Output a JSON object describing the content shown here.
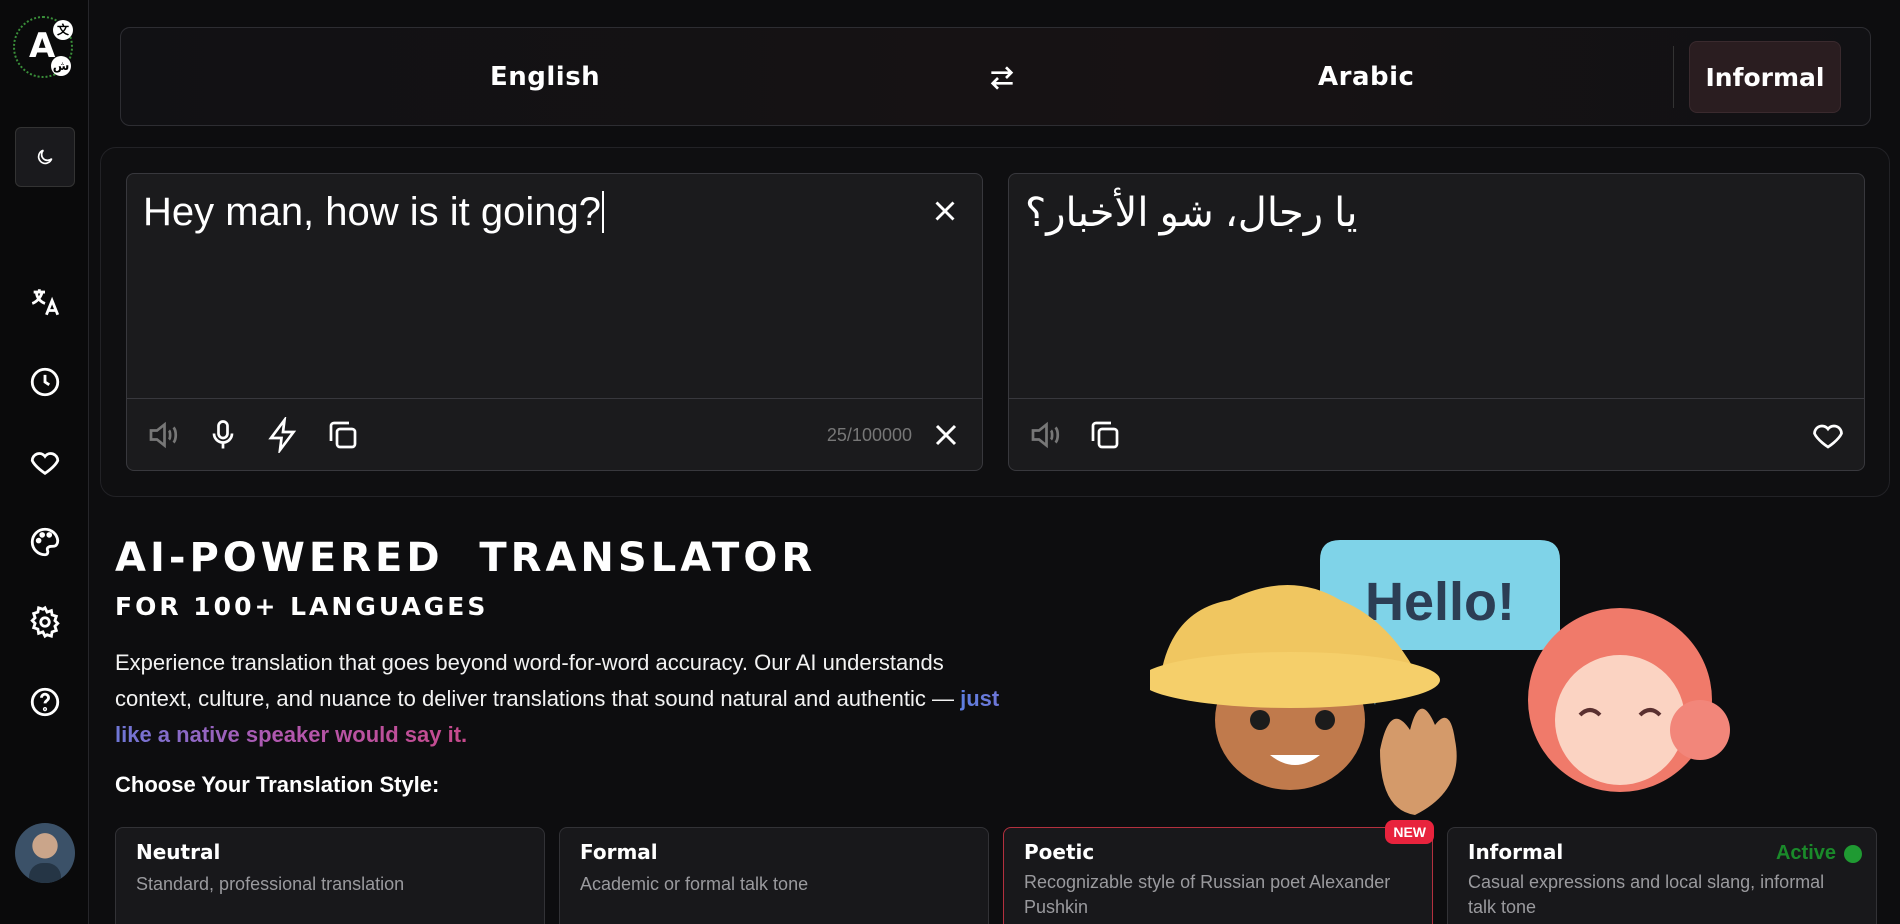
{
  "sidebar": {
    "logo": {
      "letter": "A",
      "badge1": "文",
      "badge2": "ش"
    },
    "icons": [
      "translate-icon",
      "history-icon",
      "heart-icon",
      "palette-icon",
      "settings-icon",
      "help-icon"
    ]
  },
  "topbar": {
    "source_language": "English",
    "target_language": "Arabic",
    "tone": "Informal"
  },
  "input_panel": {
    "text": "Hey man, how is it going?",
    "char_count": "25/100000"
  },
  "output_panel": {
    "text": "يا رجال، شو الأخبار؟"
  },
  "hero": {
    "title": "AI-POWERED  TRANSLATOR",
    "subtitle": "FOR 100+ LANGUAGES",
    "description": "Experience translation that goes beyond word-for-word accuracy. Our AI understands context, culture, and nuance to deliver translations that sound natural and authentic — ",
    "highlight": "just like a native speaker would say it.",
    "bubble_text": "Hello!"
  },
  "styles": {
    "heading": "Choose Your Translation Style:",
    "cards": [
      {
        "title": "Neutral",
        "desc": "Standard, professional translation"
      },
      {
        "title": "Formal",
        "desc": "Academic or formal talk tone"
      },
      {
        "title": "Poetic",
        "desc": "Recognizable style of Russian poet Alexander Pushkin",
        "badge": "NEW"
      },
      {
        "title": "Informal",
        "desc": "Casual expressions and local slang, informal talk tone",
        "status": "Active"
      }
    ]
  },
  "colors": {
    "background": "#0d0d0f",
    "panel": "#1b1b1d",
    "new_badge": "#e8233d",
    "active_green": "#1f9a32",
    "poetic_border": "#b3303e"
  }
}
